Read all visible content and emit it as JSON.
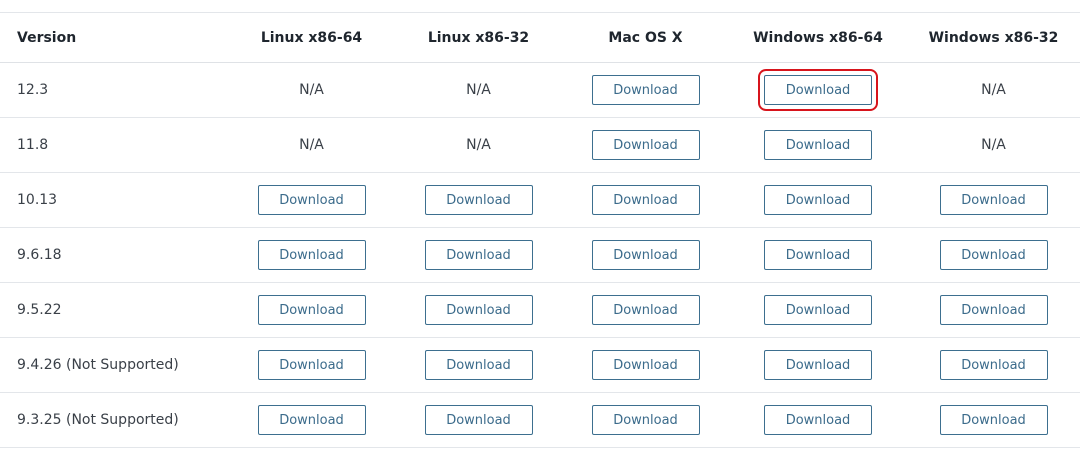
{
  "table": {
    "headers": {
      "version": "Version",
      "linux64": "Linux x86-64",
      "linux32": "Linux x86-32",
      "mac": "Mac OS X",
      "win64": "Windows x86-64",
      "win32": "Windows x86-32"
    },
    "download_label": "Download",
    "na_label": "N/A",
    "highlight_color": "#d7141c",
    "button_border_color": "#3d6f8f",
    "rows": [
      {
        "version": "12.3",
        "linux64": "N/A",
        "linux32": "N/A",
        "mac": "Download",
        "win64": "Download",
        "win32": "N/A",
        "highlighted": "win64"
      },
      {
        "version": "11.8",
        "linux64": "N/A",
        "linux32": "N/A",
        "mac": "Download",
        "win64": "Download",
        "win32": "N/A"
      },
      {
        "version": "10.13",
        "linux64": "Download",
        "linux32": "Download",
        "mac": "Download",
        "win64": "Download",
        "win32": "Download"
      },
      {
        "version": "9.6.18",
        "linux64": "Download",
        "linux32": "Download",
        "mac": "Download",
        "win64": "Download",
        "win32": "Download"
      },
      {
        "version": "9.5.22",
        "linux64": "Download",
        "linux32": "Download",
        "mac": "Download",
        "win64": "Download",
        "win32": "Download"
      },
      {
        "version": "9.4.26 (Not Supported)",
        "linux64": "Download",
        "linux32": "Download",
        "mac": "Download",
        "win64": "Download",
        "win32": "Download"
      },
      {
        "version": "9.3.25 (Not Supported)",
        "linux64": "Download",
        "linux32": "Download",
        "mac": "Download",
        "win64": "Download",
        "win32": "Download"
      }
    ]
  }
}
